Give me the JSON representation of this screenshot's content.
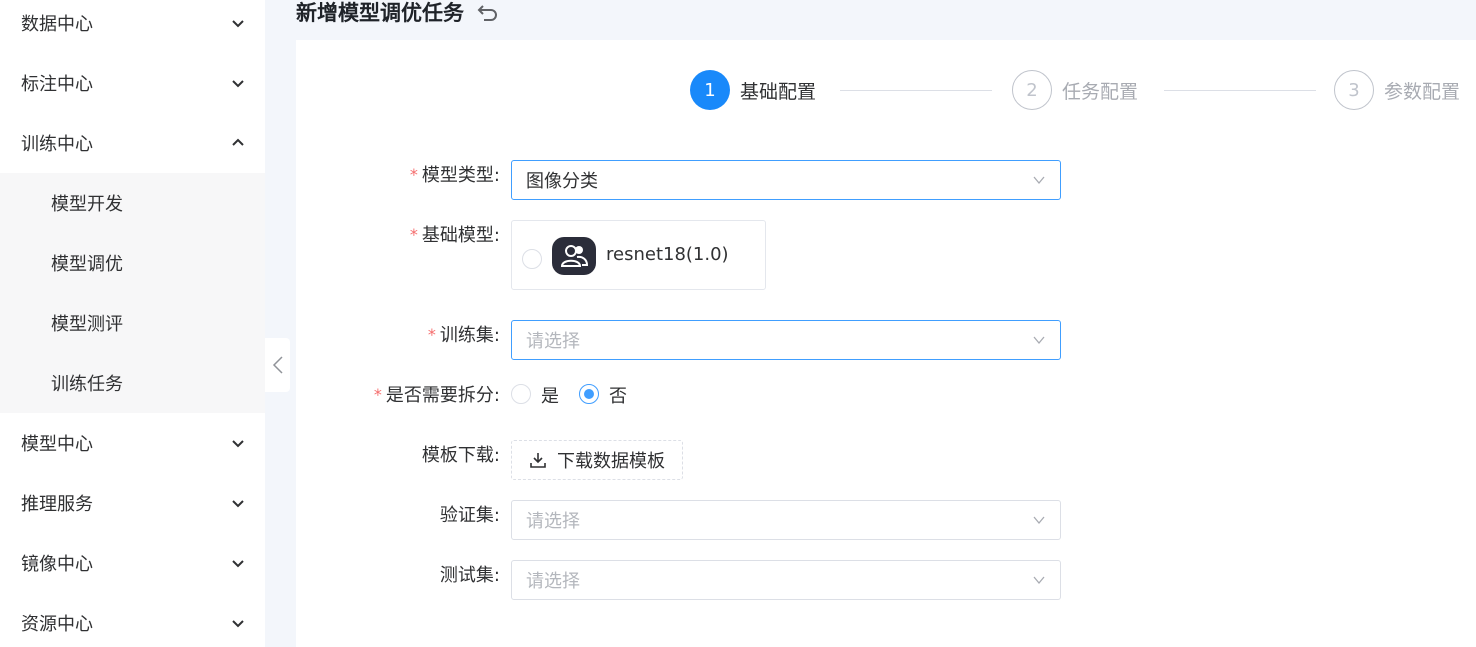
{
  "sidebar": {
    "items": [
      {
        "label": "数据中心",
        "expanded": false
      },
      {
        "label": "标注中心",
        "expanded": false
      },
      {
        "label": "训练中心",
        "expanded": true
      },
      {
        "label": "模型中心",
        "expanded": false
      },
      {
        "label": "推理服务",
        "expanded": false
      },
      {
        "label": "镜像中心",
        "expanded": false
      },
      {
        "label": "资源中心",
        "expanded": false
      }
    ],
    "sub_items": [
      {
        "label": "模型开发"
      },
      {
        "label": "模型调优"
      },
      {
        "label": "模型测评"
      },
      {
        "label": "训练任务"
      }
    ]
  },
  "header": {
    "title": "新增模型调优任务"
  },
  "steps": [
    {
      "number": "1",
      "label": "基础配置",
      "active": true
    },
    {
      "number": "2",
      "label": "任务配置",
      "active": false
    },
    {
      "number": "3",
      "label": "参数配置",
      "active": false
    }
  ],
  "form": {
    "required_mark": "*",
    "model_type": {
      "label": "模型类型:",
      "value": "图像分类"
    },
    "base_model": {
      "label": "基础模型:",
      "option": "resnet18(1.0)"
    },
    "train_set": {
      "label": "训练集:",
      "placeholder": "请选择"
    },
    "split": {
      "label": "是否需要拆分:",
      "yes": "是",
      "no": "否",
      "selected": "否"
    },
    "template": {
      "label": "模板下载:",
      "button": "下载数据模板"
    },
    "val_set": {
      "label": "验证集:",
      "placeholder": "请选择"
    },
    "test_set": {
      "label": "测试集:",
      "placeholder": "请选择"
    }
  },
  "colors": {
    "primary": "#1989fa",
    "required": "#f56c6c"
  }
}
